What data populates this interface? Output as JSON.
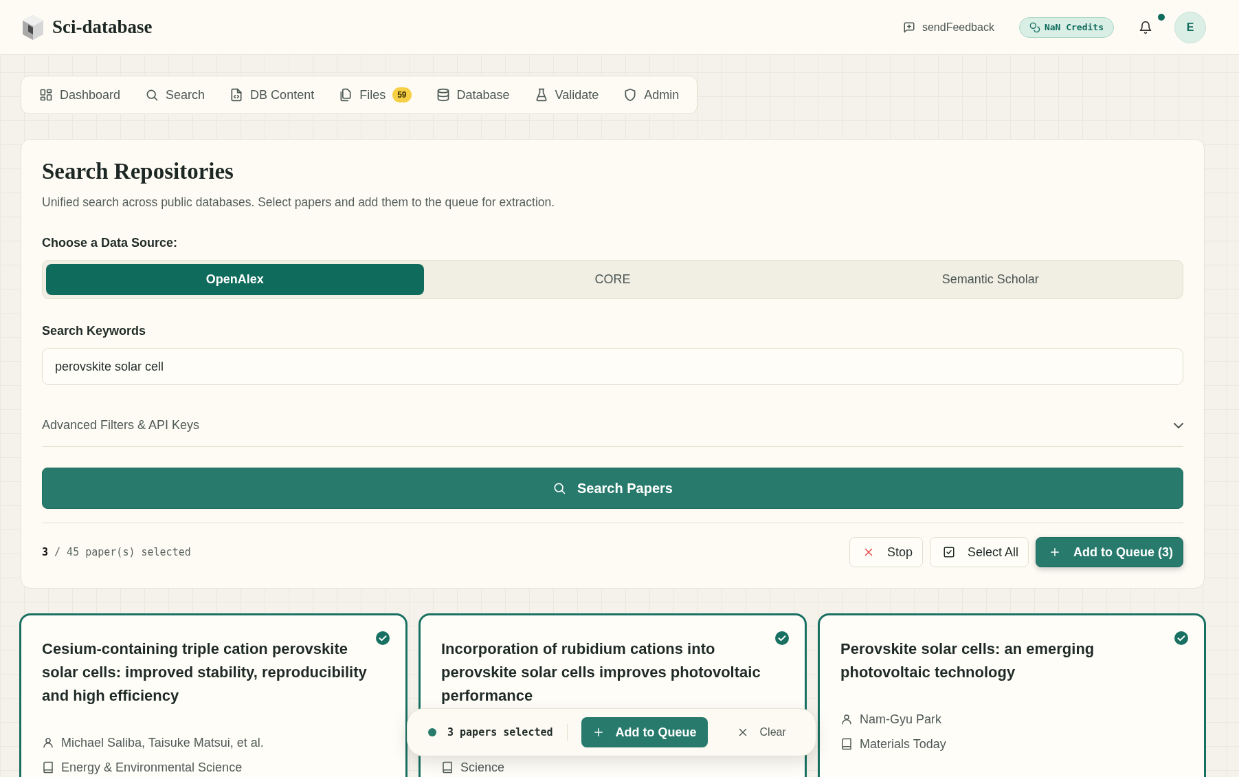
{
  "app": {
    "name": "Sci-database"
  },
  "header": {
    "feedback": "sendFeedback",
    "credits": "NaN Credits",
    "notification_dot": true,
    "avatar": "E"
  },
  "nav": [
    {
      "kind": "dashboard",
      "label": "Dashboard"
    },
    {
      "kind": "search",
      "label": "Search"
    },
    {
      "kind": "content",
      "label": "DB Content"
    },
    {
      "kind": "files",
      "label": "Files",
      "badge": "59"
    },
    {
      "kind": "database",
      "label": "Database"
    },
    {
      "kind": "validate",
      "label": "Validate"
    },
    {
      "kind": "admin",
      "label": "Admin"
    }
  ],
  "search": {
    "title": "Search Repositories",
    "subtitle": "Unified search across public databases. Select papers and add them to the queue for extraction.",
    "source_label": "Choose a Data Source:",
    "sources": [
      {
        "label": "OpenAlex",
        "selected": true
      },
      {
        "label": "CORE",
        "selected": false
      },
      {
        "label": "Semantic Scholar",
        "selected": false
      }
    ],
    "keywords_label": "Search Keywords",
    "keywords": "perovskite solar cell",
    "advanced": {
      "label": "Advanced Filters & API Keys",
      "expanded": false
    },
    "search_button": "Search Papers",
    "selection": {
      "count": "3",
      "total": "/ 45 paper(s) selected"
    },
    "actions": [
      {
        "kind": "stop",
        "label": "Stop"
      },
      {
        "kind": "select_all",
        "label": "Select All"
      },
      {
        "kind": "add",
        "label": "Add to Queue (3)"
      }
    ]
  },
  "papers": [
    {
      "title": "Cesium-containing triple cation perovskite solar cells: improved stability, reproducibility and high efficiency",
      "selected": true,
      "authors": "Michael Saliba, Taisuke Matsui, et al.",
      "venue": "Energy & Environmental Science"
    },
    {
      "title": "Incorporation of rubidium cations into perovskite solar cells improves photovoltaic performance",
      "selected": true,
      "venue": "Science"
    },
    {
      "title": "Perovskite solar cells: an emerging photovoltaic technology",
      "selected": true,
      "authors": "Nam-Gyu Park",
      "venue": "Materials Today"
    }
  ],
  "floating_bar": {
    "status": "3 papers selected",
    "add": "Add to Queue",
    "clear": "Clear"
  }
}
